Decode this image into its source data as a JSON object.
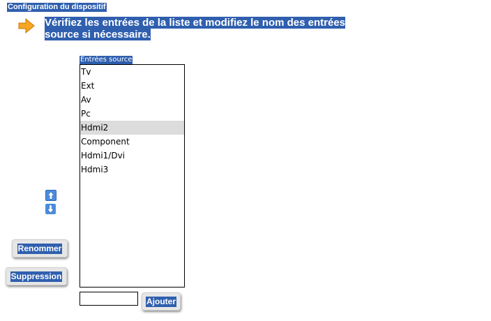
{
  "page": {
    "title": "Configuration du dispositif",
    "instruction_line1": "Vérifiez les entrées de la liste et modifiez le nom des entrées",
    "instruction_line2": "source si nécessaire."
  },
  "icons": {
    "instruction": "arrow-right-icon",
    "move_up": "arrow-up-icon",
    "move_down": "arrow-down-icon"
  },
  "source_list": {
    "label": "Entrées source",
    "selected": "Hdmi2",
    "items": [
      "Tv",
      "Ext",
      "Av",
      "Pc",
      "Hdmi2",
      "Component",
      "Hdmi1/Dvi",
      "Hdmi3"
    ]
  },
  "buttons": {
    "rename": "Renommer",
    "delete": "Suppression",
    "add": "Ajouter"
  },
  "add_input": {
    "value": ""
  },
  "colors": {
    "highlight": "#2f5fae",
    "arrow": "#f5a623",
    "selected_row": "#dcdcdc"
  }
}
